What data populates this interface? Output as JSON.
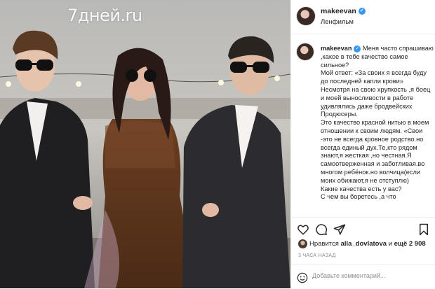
{
  "header": {
    "username": "makeevan",
    "location": "Ленфильм"
  },
  "watermark": "7дней.ru",
  "caption": {
    "username": "makeevan",
    "lines": [
      "Меня часто спрашиваю",
      ",какое в тебе качество самое",
      "сильное?",
      "Мой ответ: «За своих я всегда буду",
      "до последней капли крови»",
      "Несмотря на свою хрупкость ,я боец",
      "и моей выносливости в работе",
      "удивлялись даже бродвейских",
      "Продюсеры.",
      "Это качество красной нитью в моем",
      "отношении к своим людям. «Свои",
      "-это не всегда кровное родство.но",
      "всегда единый дух.Те,кто рядом",
      "знают,я жесткая ,но честная.Я",
      "самоотверженная и заботливая.во",
      "многом ребёнок.но волчица(если",
      "моих обижают,я не отступлю)",
      "Какие качества есть у вас?",
      "С чем вы боретесь ,а что"
    ]
  },
  "likes": {
    "prefix": "Нравится",
    "user": "alla_dovlatova",
    "middle": "и",
    "count": "ещё 2 908"
  },
  "time_ago": "3 ЧАСА НАЗАД",
  "comment": {
    "placeholder": "Добавьте комментарий..."
  },
  "icons": {
    "like": "heart-icon",
    "comment": "comment-icon",
    "share": "share-icon",
    "save": "bookmark-icon",
    "emoji": "smile-icon",
    "verified": "verified-badge-icon"
  },
  "colors": {
    "verified": "#3897f0",
    "border": "#efefef",
    "muted": "#8e8e8e"
  }
}
